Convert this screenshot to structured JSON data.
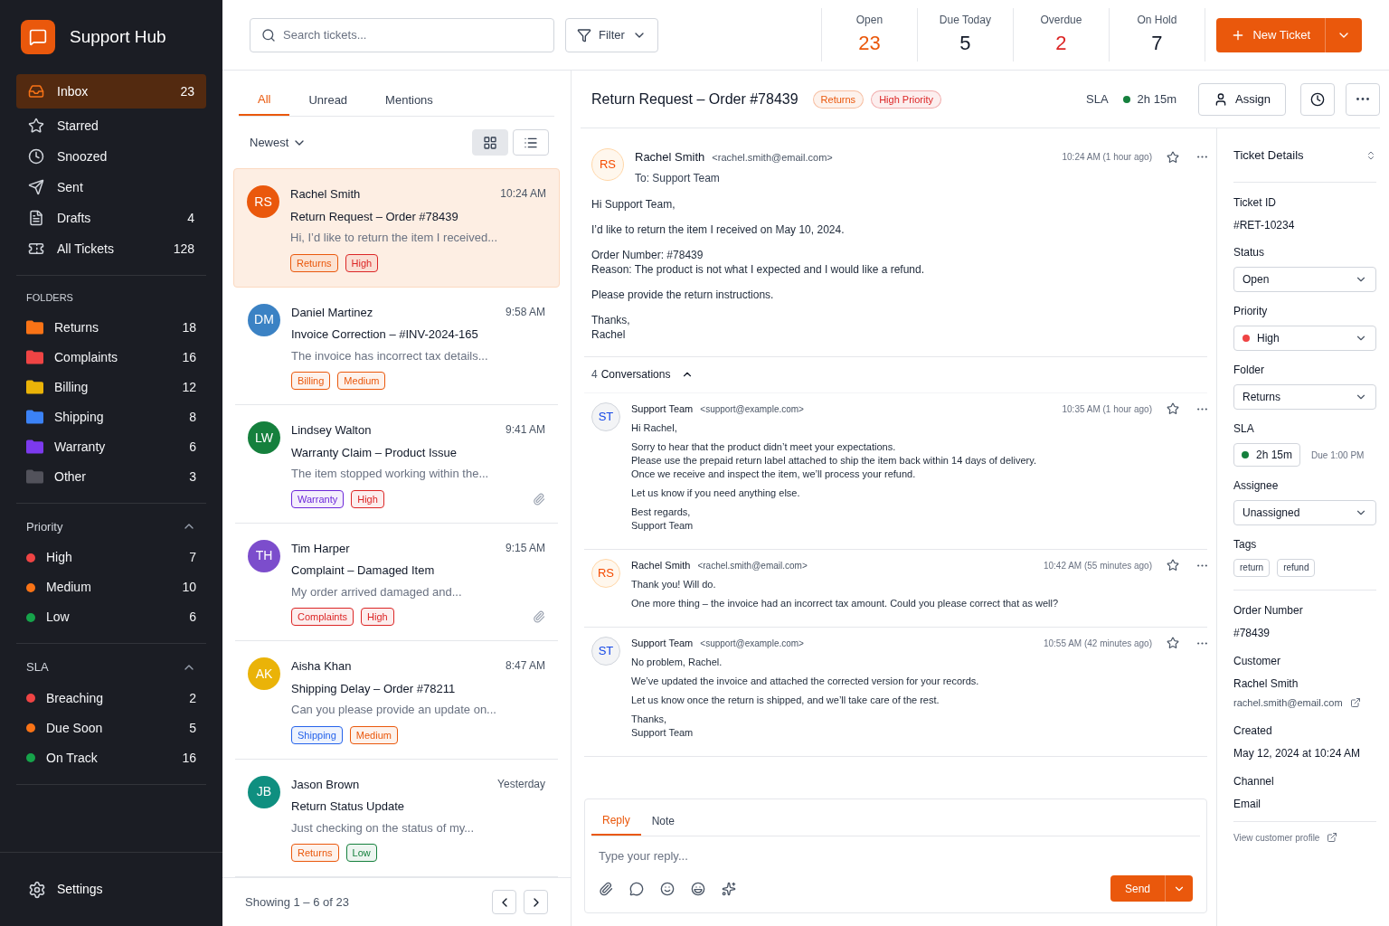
{
  "app": {
    "name": "Support Hub"
  },
  "nav": [
    {
      "label": "Inbox",
      "count": "23",
      "selected": true
    },
    {
      "label": "Starred",
      "selected": false
    },
    {
      "label": "Snoozed",
      "selected": false
    },
    {
      "label": "Sent",
      "selected": false
    },
    {
      "label": "Drafts",
      "count": "4",
      "selected": false
    },
    {
      "label": "All Tickets",
      "count": "128",
      "selected": false
    }
  ],
  "folders": {
    "title": "FOLDERS",
    "items": [
      {
        "label": "Returns",
        "count": "18",
        "color": "#f97316"
      },
      {
        "label": "Complaints",
        "count": "16",
        "color": "#ef4444"
      },
      {
        "label": "Billing",
        "count": "12",
        "color": "#eab308"
      },
      {
        "label": "Shipping",
        "count": "8",
        "color": "#3b82f6"
      },
      {
        "label": "Warranty",
        "count": "6",
        "color": "#7c3aed"
      },
      {
        "label": "Other",
        "count": "3",
        "color": "#52525b"
      }
    ]
  },
  "priority": {
    "title": "Priority",
    "expanded": true,
    "items": [
      {
        "label": "High",
        "count": "7",
        "color": "#ef4444"
      },
      {
        "label": "Medium",
        "count": "10",
        "color": "#f97316"
      },
      {
        "label": "Low",
        "count": "6",
        "color": "#16a34a"
      }
    ]
  },
  "sla": {
    "title": "SLA",
    "expanded": true,
    "items": [
      {
        "label": "Breaching",
        "count": "2",
        "color": "#ef4444"
      },
      {
        "label": "Due Soon",
        "count": "5",
        "color": "#f97316"
      },
      {
        "label": "On Track",
        "count": "16",
        "color": "#16a34a"
      }
    ]
  },
  "settings": {
    "label": "Settings"
  },
  "search": {
    "placeholder": "Search tickets..."
  },
  "filter": {
    "label": "Filter"
  },
  "stats": [
    {
      "label": "Open",
      "value": "23",
      "color": "#ea580c"
    },
    {
      "label": "Due Today",
      "value": "5",
      "color": "#111827"
    },
    {
      "label": "Overdue",
      "value": "2",
      "color": "#dc2626"
    },
    {
      "label": "On Hold",
      "value": "7",
      "color": "#111827"
    }
  ],
  "new_ticket": {
    "label": "New Ticket"
  },
  "list": {
    "tabs": [
      {
        "label": "All",
        "selected": true
      },
      {
        "label": "Unread",
        "selected": false
      },
      {
        "label": "Mentions",
        "selected": false
      }
    ],
    "sort": "Newest",
    "views": [
      {
        "selected": true
      },
      {
        "selected": false
      }
    ],
    "tickets": [
      {
        "initials": "RS",
        "color": "#ea580c",
        "name": "Rachel Smith",
        "time": "10:24 AM",
        "subject": "Return Request – Order #78439",
        "preview": "Hi, I’d like to return the item I received...",
        "tags": [
          {
            "label": "Returns",
            "color": "#ea580c"
          },
          {
            "label": "High",
            "color": "#dc2626"
          }
        ],
        "attachment": false,
        "selected": true
      },
      {
        "initials": "DM",
        "color": "#3b82c4",
        "name": "Daniel Martinez",
        "time": "9:58 AM",
        "subject": "Invoice Correction – #INV-2024-165",
        "preview": "The invoice has incorrect tax details...",
        "tags": [
          {
            "label": "Billing",
            "color": "#ea580c"
          },
          {
            "label": "Medium",
            "color": "#ea580c"
          }
        ],
        "attachment": false,
        "selected": false
      },
      {
        "initials": "LW",
        "color": "#15803d",
        "name": "Lindsey Walton",
        "time": "9:41 AM",
        "subject": "Warranty Claim – Product Issue",
        "preview": "The item stopped working within the...",
        "tags": [
          {
            "label": "Warranty",
            "color": "#6d28d9"
          },
          {
            "label": "High",
            "color": "#dc2626"
          }
        ],
        "attachment": true,
        "selected": false
      },
      {
        "initials": "TH",
        "color": "#7c4dcc",
        "name": "Tim Harper",
        "time": "9:15 AM",
        "subject": "Complaint – Damaged Item",
        "preview": "My order arrived damaged and...",
        "tags": [
          {
            "label": "Complaints",
            "color": "#dc2626"
          },
          {
            "label": "High",
            "color": "#dc2626"
          }
        ],
        "attachment": true,
        "selected": false
      },
      {
        "initials": "AK",
        "color": "#eab308",
        "name": "Aisha Khan",
        "time": "8:47 AM",
        "subject": "Shipping Delay – Order #78211",
        "preview": "Can you please provide an update on...",
        "tags": [
          {
            "label": "Shipping",
            "color": "#2563eb"
          },
          {
            "label": "Medium",
            "color": "#ea580c"
          }
        ],
        "attachment": false,
        "selected": false
      },
      {
        "initials": "JB",
        "color": "#0f8f80",
        "name": "Jason Brown",
        "time": "Yesterday",
        "subject": "Return Status Update",
        "preview": "Just checking on the status of my...",
        "tags": [
          {
            "label": "Returns",
            "color": "#ea580c"
          },
          {
            "label": "Low",
            "color": "#15803d"
          }
        ],
        "attachment": false,
        "selected": false
      }
    ],
    "pagination": "Showing 1 – 6 of 23"
  },
  "thread": {
    "title": "Return Request – Order #78439",
    "tags": [
      {
        "label": "Returns",
        "color": "#ea580c"
      },
      {
        "label": "High Priority",
        "color": "#dc2626"
      }
    ],
    "sla": {
      "label": "SLA",
      "value": "2h 15m",
      "color": "#15803d"
    },
    "assign": "Assign",
    "message": {
      "initials": "RS",
      "name": "Rachel Smith",
      "email": "<rachel.smith@email.com>",
      "to": "To: Support Team",
      "time": "10:24 AM (1 hour ago)",
      "paragraphs": [
        [
          "Hi Support Team,"
        ],
        [
          "I’d like to return the item I received on May 10, 2024."
        ],
        [
          "Order Number: #78439",
          "Reason: The product is not what I expected and I would like a refund."
        ],
        [
          "Please provide the return instructions."
        ],
        [
          "Thanks,",
          "Rachel"
        ]
      ]
    },
    "conversations": {
      "count": "4",
      "label": "Conversations",
      "expanded": true
    },
    "replies": [
      {
        "initials": "ST",
        "kind": "agent",
        "name": "Support Team",
        "email": "<support@example.com>",
        "time": "10:35 AM (1 hour ago)",
        "paragraphs": [
          [
            "Hi Rachel,"
          ],
          [
            "Sorry to hear that the product didn’t meet your expectations.",
            "Please use the prepaid return label attached to ship the item back within 14 days of delivery.",
            "Once we receive and inspect the item, we’ll process your refund."
          ],
          [
            "Let us know if you need anything else."
          ],
          [
            "Best regards,",
            "Support Team"
          ]
        ]
      },
      {
        "initials": "RS",
        "kind": "customer",
        "name": "Rachel Smith",
        "email": "<rachel.smith@email.com>",
        "time": "10:42 AM (55 minutes ago)",
        "paragraphs": [
          [
            "Thank you! Will do."
          ],
          [
            "One more thing – the invoice had an incorrect tax amount. Could you please correct that as well?"
          ]
        ]
      },
      {
        "initials": "ST",
        "kind": "agent",
        "name": "Support Team",
        "email": "<support@example.com>",
        "time": "10:55 AM (42 minutes ago)",
        "paragraphs": [
          [
            "No problem, Rachel."
          ],
          [
            "We’ve updated the invoice and attached the corrected version for your records."
          ],
          [
            "Let us know once the return is shipped, and we’ll take care of the rest."
          ],
          [
            "Thanks,",
            "Support Team"
          ]
        ]
      }
    ],
    "composer": {
      "tabs": [
        {
          "label": "Reply",
          "selected": true
        },
        {
          "label": "Note",
          "selected": false
        }
      ],
      "placeholder": "Type your reply...",
      "send": "Send"
    }
  },
  "details": {
    "title": "Ticket Details",
    "fields": [
      {
        "kind": "text",
        "label": "Ticket ID",
        "value": "#RET-10234"
      },
      {
        "kind": "select",
        "label": "Status",
        "value": "Open"
      },
      {
        "kind": "select",
        "label": "Priority",
        "value": "High",
        "color": "#ef4444"
      },
      {
        "kind": "select",
        "label": "Folder",
        "value": "Returns"
      },
      {
        "kind": "sla",
        "label": "SLA",
        "value": "2h 15m",
        "color": "#15803d",
        "note": "Due 1:00 PM"
      },
      {
        "kind": "select",
        "label": "Assignee",
        "value": "Unassigned"
      },
      {
        "kind": "tags",
        "label": "Tags",
        "tags": [
          "return",
          "refund"
        ]
      },
      {
        "kind": "divider"
      },
      {
        "kind": "text",
        "label": "Order Number",
        "value": "#78439"
      },
      {
        "kind": "customer",
        "label": "Customer",
        "value": "Rachel Smith",
        "email": "rachel.smith@email.com"
      },
      {
        "kind": "text",
        "label": "Created",
        "value": "May 12, 2024 at 10:24 AM"
      },
      {
        "kind": "text",
        "label": "Channel",
        "value": "Email"
      }
    ],
    "link": "View customer profile"
  }
}
